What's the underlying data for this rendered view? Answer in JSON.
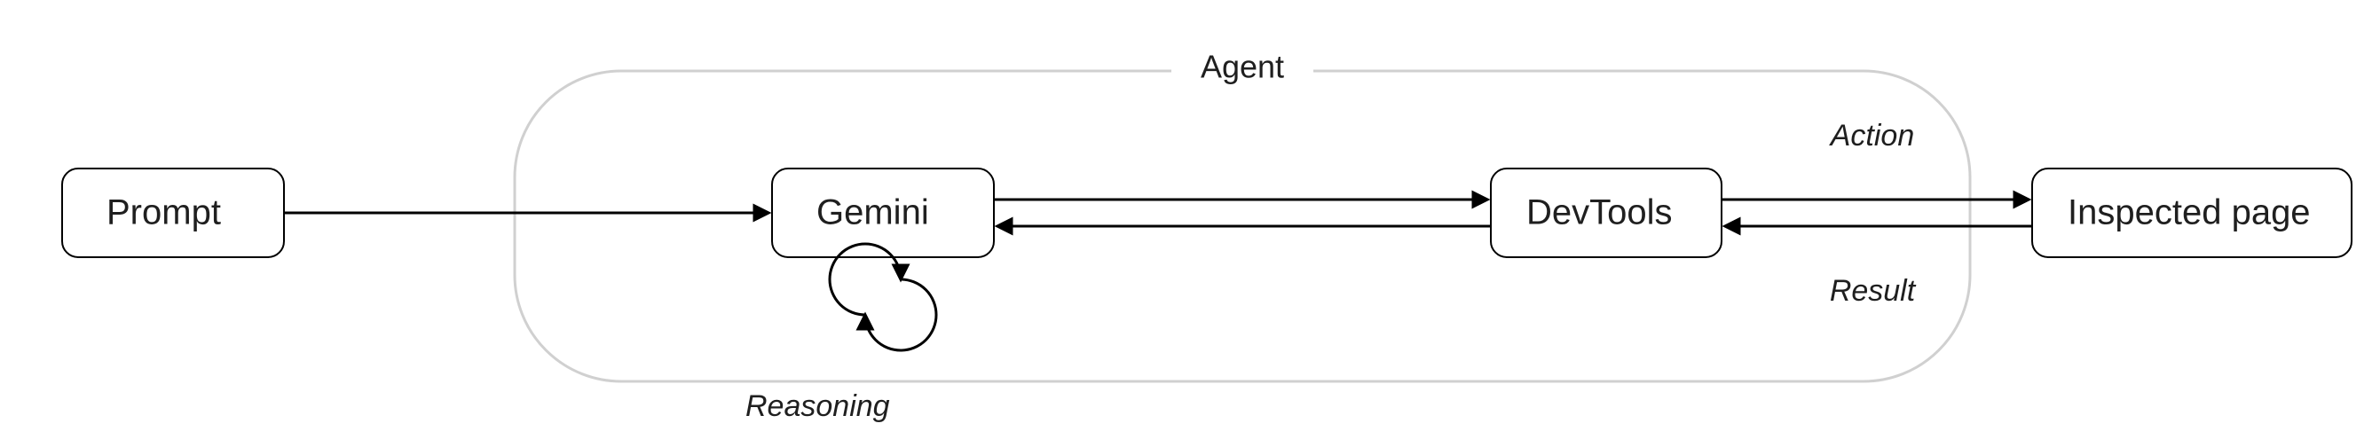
{
  "diagram": {
    "agent_group_label": "Agent",
    "nodes": {
      "prompt": "Prompt",
      "gemini": "Gemini",
      "devtools": "DevTools",
      "inspected_page": "Inspected page"
    },
    "edge_labels": {
      "reasoning": "Reasoning",
      "action": "Action",
      "result": "Result"
    }
  }
}
